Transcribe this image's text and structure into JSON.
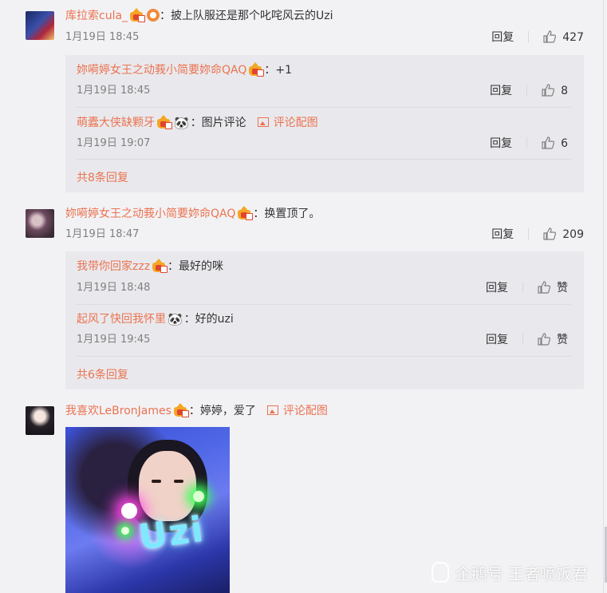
{
  "comments": [
    {
      "name": "库拉索cula_",
      "text": "：披上队服还是那个叱咤风云的Uzi",
      "time": "1月19日 18:45",
      "reply_label": "回复",
      "likes": "427",
      "replies": [
        {
          "name": "妳嗬婷女王之动莪小简要妳命QAQ",
          "text": "：+1",
          "time": "1月19日 18:45",
          "reply_label": "回复",
          "likes": "8"
        },
        {
          "name": "萌蠹大侠缺颗牙",
          "text": "：图片评论",
          "pic_link": "评论配图",
          "time": "1月19日 19:07",
          "reply_label": "回复",
          "likes": "6"
        }
      ],
      "more": "共8条回复"
    },
    {
      "name": "妳嗬婷女王之动莪小简要妳命QAQ",
      "text": "：换置顶了。",
      "time": "1月19日 18:47",
      "reply_label": "回复",
      "likes": "209",
      "replies": [
        {
          "name": "我带你回家zzz",
          "text": "：最好的咪",
          "time": "1月19日 18:48",
          "reply_label": "回复",
          "likes": "赞"
        },
        {
          "name": "起风了快回我怀里",
          "text": "：好的uzi",
          "time": "1月19日 19:45",
          "reply_label": "回复",
          "likes": "赞"
        }
      ],
      "more": "共6条回复"
    },
    {
      "name": "我喜欢LeBronJames",
      "text": "：婷婷，爱了",
      "pic_link": "评论配图"
    }
  ],
  "emoji": {
    "panda": "🐼"
  },
  "photo_sign": "Uzi",
  "watermark": "企鹅号 王者喷饭君",
  "colors": {
    "name": "#eb7350",
    "background": "#f2f2f5",
    "reply_box": "#e9e9ed"
  },
  "icons": [
    "thumbs-up-icon",
    "vip-crown-badge-icon",
    "picture-icon",
    "panda-emoji-icon",
    "penguin-icon"
  ]
}
